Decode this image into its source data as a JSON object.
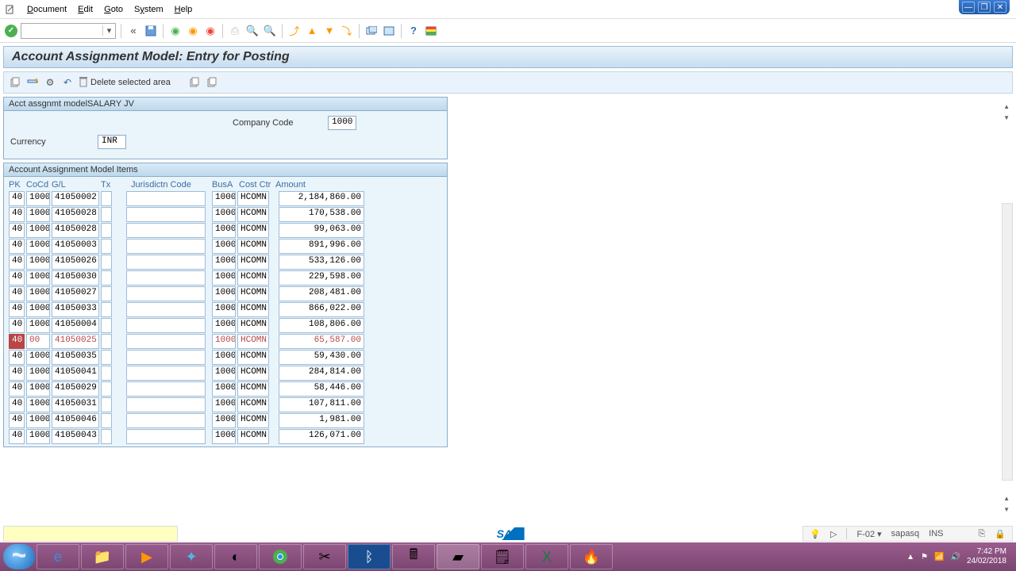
{
  "menu": {
    "items": [
      "Document",
      "Edit",
      "Goto",
      "System",
      "Help"
    ]
  },
  "page_title": "Account Assignment Model: Entry for Posting",
  "toolbar2": {
    "delete_label": "Delete selected area"
  },
  "header_panel": {
    "model_label": "Acct assgnmt model",
    "model_value": "SALARY JV",
    "company_code_label": "Company Code",
    "company_code_value": "1000",
    "currency_label": "Currency",
    "currency_value": "INR"
  },
  "items_panel": {
    "title": "Account Assignment Model Items",
    "columns": {
      "pk": "PK",
      "cocd": "CoCd",
      "gl": "G/L",
      "tx": "Tx",
      "jur": "Jurisdictn Code",
      "busa": "BusA",
      "costctr": "Cost Ctr",
      "amount": "Amount"
    },
    "rows": [
      {
        "pk": "40",
        "cocd": "1000",
        "gl": "41050002",
        "busa": "1000",
        "cc": "HCOMN",
        "amount": "2,184,860.00",
        "hl": false
      },
      {
        "pk": "40",
        "cocd": "1000",
        "gl": "41050028",
        "busa": "1000",
        "cc": "HCOMN",
        "amount": "170,538.00",
        "hl": false
      },
      {
        "pk": "40",
        "cocd": "1000",
        "gl": "41050028",
        "busa": "1000",
        "cc": "HCOMN",
        "amount": "99,063.00",
        "hl": false
      },
      {
        "pk": "40",
        "cocd": "1000",
        "gl": "41050003",
        "busa": "1000",
        "cc": "HCOMN",
        "amount": "891,996.00",
        "hl": false
      },
      {
        "pk": "40",
        "cocd": "1000",
        "gl": "41050026",
        "busa": "1000",
        "cc": "HCOMN",
        "amount": "533,126.00",
        "hl": false
      },
      {
        "pk": "40",
        "cocd": "1000",
        "gl": "41050030",
        "busa": "1000",
        "cc": "HCOMN",
        "amount": "229,598.00",
        "hl": false
      },
      {
        "pk": "40",
        "cocd": "1000",
        "gl": "41050027",
        "busa": "1000",
        "cc": "HCOMN",
        "amount": "208,481.00",
        "hl": false
      },
      {
        "pk": "40",
        "cocd": "1000",
        "gl": "41050033",
        "busa": "1000",
        "cc": "HCOMN",
        "amount": "866,022.00",
        "hl": false
      },
      {
        "pk": "40",
        "cocd": "1000",
        "gl": "41050004",
        "busa": "1000",
        "cc": "HCOMN",
        "amount": "108,806.00",
        "hl": false
      },
      {
        "pk": "40",
        "cocd": "00",
        "gl": "41050025",
        "busa": "1000",
        "cc": "HCOMN",
        "amount": "65,587.00",
        "hl": true
      },
      {
        "pk": "40",
        "cocd": "1000",
        "gl": "41050035",
        "busa": "1000",
        "cc": "HCOMN",
        "amount": "59,430.00",
        "hl": false
      },
      {
        "pk": "40",
        "cocd": "1000",
        "gl": "41050041",
        "busa": "1000",
        "cc": "HCOMN",
        "amount": "284,814.00",
        "hl": false
      },
      {
        "pk": "40",
        "cocd": "1000",
        "gl": "41050029",
        "busa": "1000",
        "cc": "HCOMN",
        "amount": "58,446.00",
        "hl": false
      },
      {
        "pk": "40",
        "cocd": "1000",
        "gl": "41050031",
        "busa": "1000",
        "cc": "HCOMN",
        "amount": "107,811.00",
        "hl": false
      },
      {
        "pk": "40",
        "cocd": "1000",
        "gl": "41050046",
        "busa": "1000",
        "cc": "HCOMN",
        "amount": "1,981.00",
        "hl": false
      },
      {
        "pk": "40",
        "cocd": "1000",
        "gl": "41050043",
        "busa": "1000",
        "cc": "HCOMN",
        "amount": "126,071.00",
        "hl": false
      }
    ]
  },
  "statusbar": {
    "tcode": "F-02",
    "user": "sapasq",
    "mode": "INS"
  },
  "tray": {
    "time": "7:42 PM",
    "date": "24/02/2018"
  }
}
